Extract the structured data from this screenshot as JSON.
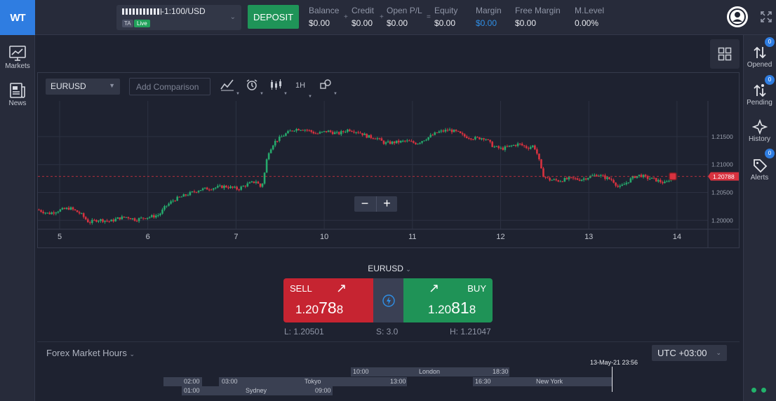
{
  "header": {
    "logo_text": "WT",
    "account_name": "-1:100/USD",
    "account_tag": "TA",
    "account_mode": "Live",
    "deposit_label": "DEPOSIT",
    "stats": [
      {
        "label": "Balance",
        "value": "$0.00"
      },
      {
        "label": "Credit",
        "value": "$0.00"
      },
      {
        "label": "Open P/L",
        "value": "$0.00"
      },
      {
        "label": "Equity",
        "value": "$0.00"
      },
      {
        "label": "Margin",
        "value": "$0.00"
      },
      {
        "label": "Free Margin",
        "value": "$0.00"
      },
      {
        "label": "M.Level",
        "value": "0.00%"
      }
    ],
    "operators": [
      "+",
      "+",
      "="
    ],
    "margin_value_color": "#2f8fe6"
  },
  "left_nav": [
    {
      "label": "Markets",
      "icon": "chart-monitor-icon"
    },
    {
      "label": "News",
      "icon": "newspaper-icon"
    }
  ],
  "right_nav": [
    {
      "label": "Opened",
      "icon": "up-down-arrows-icon",
      "badge": "0"
    },
    {
      "label": "Pending",
      "icon": "pending-arrows-icon",
      "badge": "0"
    },
    {
      "label": "History",
      "icon": "history-star-icon",
      "badge": ""
    },
    {
      "label": "Alerts",
      "icon": "alert-tag-icon",
      "badge": "0"
    }
  ],
  "chart_toolbar": {
    "symbol": "EURUSD",
    "compare_placeholder": "Add Comparison",
    "timeframe": "1H"
  },
  "chart_data": {
    "type": "candlestick",
    "symbol": "EURUSD",
    "x_ticks": [
      "5",
      "6",
      "7",
      "10",
      "11",
      "12",
      "13",
      "14"
    ],
    "y_ticks": [
      "1.21500",
      "1.21000",
      "1.20500",
      "1.20000"
    ],
    "ylim": [
      1.1984,
      1.2214
    ],
    "current_price": "1.20788",
    "current_price_value": 1.20788,
    "bull_color": "#26a96c",
    "bear_color": "#d8323f",
    "grid": true,
    "zoom_out_label": "−",
    "zoom_in_label": "+",
    "path_closes": [
      [
        0,
        1.2019
      ],
      [
        10,
        1.2012
      ],
      [
        20,
        1.2018
      ],
      [
        30,
        1.2022
      ],
      [
        40,
        1.2012
      ],
      [
        48,
        1.1996
      ],
      [
        56,
        1.2001
      ],
      [
        62,
        1.2
      ],
      [
        68,
        1.1998
      ],
      [
        76,
        1.2004
      ],
      [
        84,
        1.2006
      ],
      [
        92,
        1.2001
      ],
      [
        100,
        1.2005
      ],
      [
        108,
        1.2007
      ],
      [
        114,
        1.201
      ],
      [
        120,
        1.2025
      ],
      [
        128,
        1.2037
      ],
      [
        140,
        1.2046
      ],
      [
        152,
        1.2055
      ],
      [
        164,
        1.2058
      ],
      [
        176,
        1.2061
      ],
      [
        188,
        1.2056
      ],
      [
        196,
        1.2064
      ],
      [
        205,
        1.207
      ],
      [
        210,
        1.2058
      ],
      [
        213,
        1.2085
      ],
      [
        216,
        1.212
      ],
      [
        222,
        1.214
      ],
      [
        232,
        1.2154
      ],
      [
        240,
        1.2163
      ],
      [
        247,
        1.2164
      ],
      [
        253,
        1.2162
      ],
      [
        262,
        1.2155
      ],
      [
        272,
        1.216
      ],
      [
        282,
        1.2155
      ],
      [
        292,
        1.2163
      ],
      [
        302,
        1.2158
      ],
      [
        310,
        1.215
      ],
      [
        318,
        1.2148
      ],
      [
        326,
        1.2138
      ],
      [
        336,
        1.214
      ],
      [
        346,
        1.2142
      ],
      [
        356,
        1.2138
      ],
      [
        366,
        1.2148
      ],
      [
        376,
        1.2158
      ],
      [
        386,
        1.2162
      ],
      [
        394,
        1.2158
      ],
      [
        400,
        1.2151
      ],
      [
        410,
        1.2147
      ],
      [
        420,
        1.2148
      ],
      [
        428,
        1.2132
      ],
      [
        436,
        1.2128
      ],
      [
        444,
        1.2133
      ],
      [
        452,
        1.2137
      ],
      [
        460,
        1.213
      ],
      [
        466,
        1.2134
      ],
      [
        470,
        1.2115
      ],
      [
        474,
        1.2082
      ],
      [
        480,
        1.2073
      ],
      [
        490,
        1.2071
      ],
      [
        500,
        1.2075
      ],
      [
        510,
        1.2073
      ],
      [
        518,
        1.2078
      ],
      [
        526,
        1.2082
      ],
      [
        534,
        1.2076
      ],
      [
        540,
        1.2072
      ],
      [
        546,
        1.2058
      ],
      [
        552,
        1.2066
      ],
      [
        560,
        1.2078
      ],
      [
        566,
        1.2081
      ],
      [
        572,
        1.2076
      ],
      [
        578,
        1.2074
      ],
      [
        584,
        1.207
      ],
      [
        590,
        1.2066
      ],
      [
        596,
        1.208
      ]
    ]
  },
  "trade": {
    "symbol": "EURUSD",
    "sell_label": "SELL",
    "sell_price_prefix": "1.20",
    "sell_price_big": "78",
    "sell_price_suffix": "8",
    "buy_label": "BUY",
    "buy_price_prefix": "1.20",
    "buy_price_big": "81",
    "buy_price_suffix": "8",
    "low": "L: 1.20501",
    "spread": "S: 3.0",
    "high": "H: 1.21047"
  },
  "market_hours": {
    "title": "Forex Market Hours",
    "timezone": "UTC +03:00",
    "now_label": "13-May-21 23:56",
    "sessions": [
      {
        "name": "London",
        "start": "10:00",
        "end": "18:30"
      },
      {
        "name": "Tokyo",
        "start": "03:00",
        "end": "13:00"
      },
      {
        "name": "New York",
        "start": "16:30",
        "end": ""
      },
      {
        "name": "",
        "start": "02:00",
        "end": ""
      },
      {
        "name": "Sydney",
        "start": "01:00",
        "end": "09:00"
      }
    ]
  }
}
